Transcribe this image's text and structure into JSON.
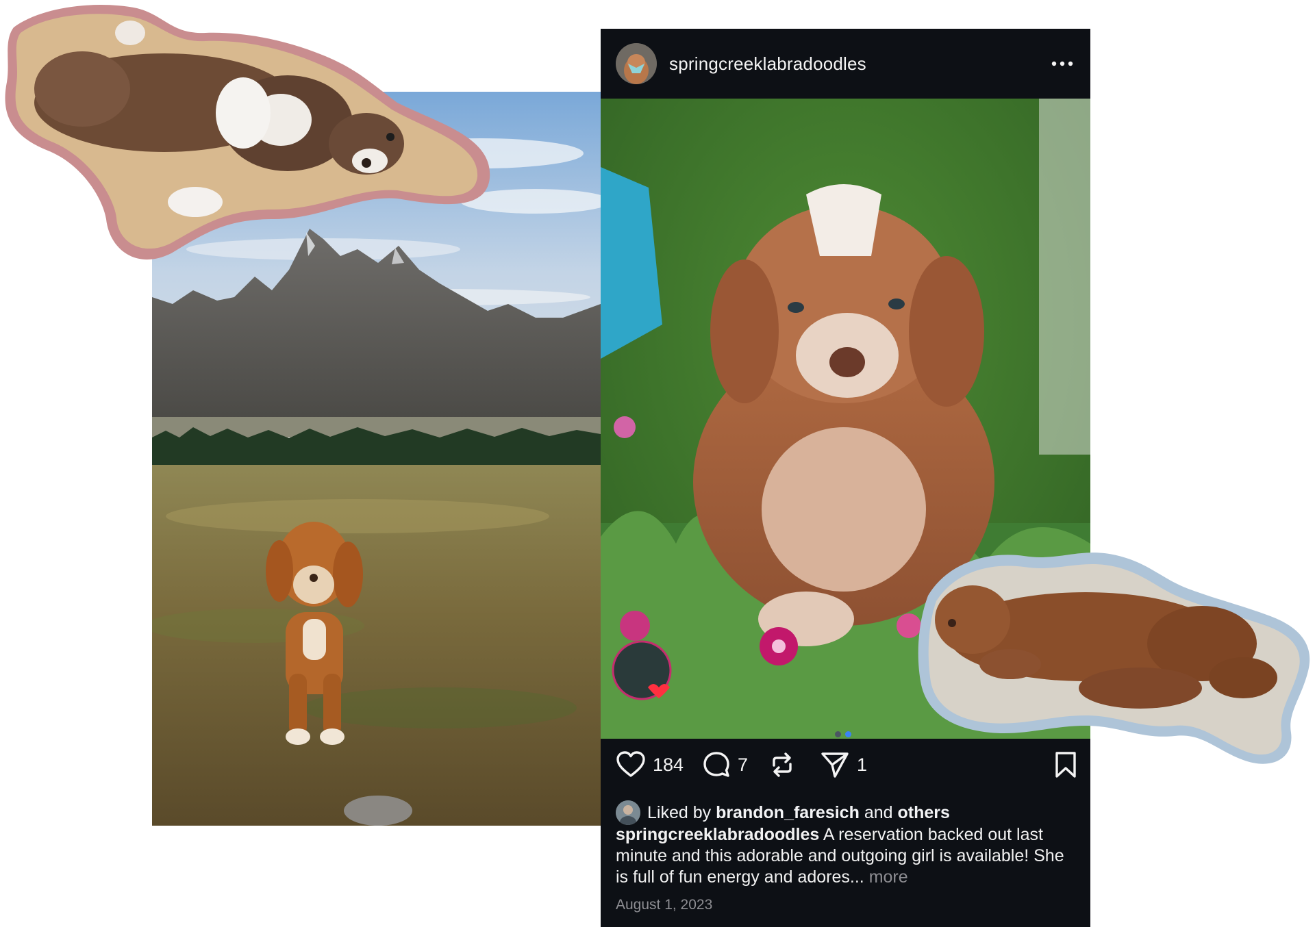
{
  "post": {
    "username": "springcreeklabradoodles",
    "like_icon": "heart-icon",
    "likes_count": "184",
    "comment_icon": "comment-icon",
    "comments_count": "7",
    "repost_icon": "repost-icon",
    "share_icon": "send-icon",
    "shares_count": "1",
    "save_icon": "bookmark-icon",
    "more_icon": "more-horizontal-icon",
    "liked_by_prefix": "Liked by",
    "liked_by_user": "brandon_faresich",
    "liked_by_and": "and",
    "liked_by_others": "others",
    "caption_user": "springcreeklabradoodles",
    "caption_text": "A reservation backed out last minute and this adorable and outgoing girl is available! She is full of fun energy and adores...",
    "caption_more": "more",
    "date": "August 1, 2023",
    "carousel": {
      "total": 2,
      "active": 2
    }
  },
  "colors": {
    "post_background": "#0d1015",
    "active_dot": "#3b82f6",
    "inactive_dot": "#4b5563",
    "sticker_pink_outline": "#c98d8f",
    "sticker_blue_outline": "#aec4d8"
  }
}
